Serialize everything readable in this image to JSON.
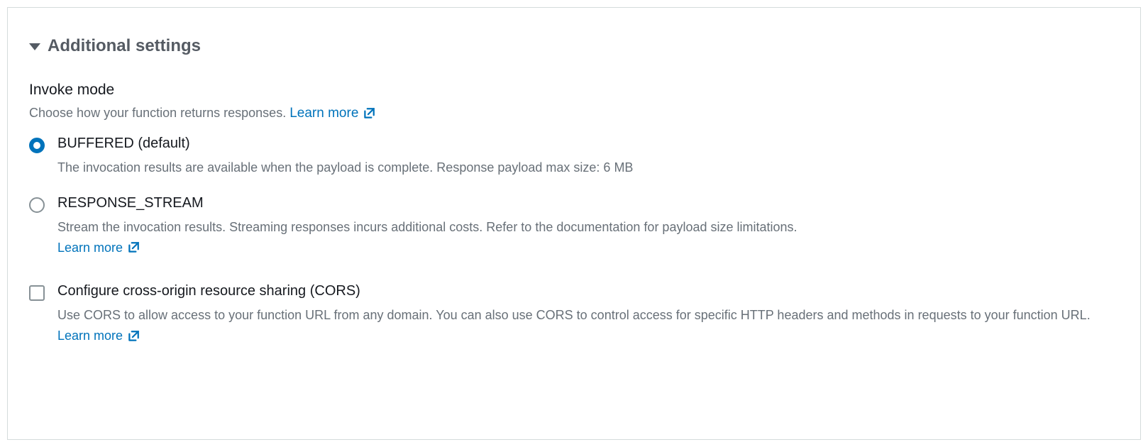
{
  "section": {
    "title": "Additional settings"
  },
  "invokeMode": {
    "heading": "Invoke mode",
    "description": "Choose how your function returns responses.",
    "learnMore": "Learn more",
    "options": [
      {
        "label": "BUFFERED (default)",
        "description": "The invocation results are available when the payload is complete. Response payload max size: 6 MB",
        "selected": true,
        "hasLearnMore": false
      },
      {
        "label": "RESPONSE_STREAM",
        "description": "Stream the invocation results. Streaming responses incurs additional costs. Refer to the documentation for payload size limitations.",
        "selected": false,
        "hasLearnMore": true,
        "learnMore": "Learn more"
      }
    ]
  },
  "cors": {
    "label": "Configure cross-origin resource sharing (CORS)",
    "description": "Use CORS to allow access to your function URL from any domain. You can also use CORS to control access for specific HTTP headers and methods in requests to your function URL.",
    "learnMore": "Learn more",
    "checked": false
  }
}
